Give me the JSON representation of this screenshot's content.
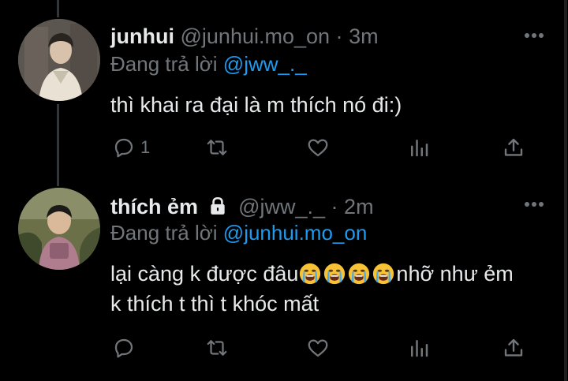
{
  "tweets": [
    {
      "display_name": "junhui",
      "handle": "@junhui.mo_on",
      "separator": "·",
      "time": "3m",
      "reply_prefix": "Đang trả lời",
      "reply_mention": "@jww_._",
      "body_lines": [
        "thì khai ra đại là m thích nó đi:)"
      ],
      "reply_count": "1"
    },
    {
      "display_name": "thích ẻm",
      "handle": "@jww_._",
      "separator": "·",
      "time": "2m",
      "reply_prefix": "Đang trả lời",
      "reply_mention": "@junhui.mo_on",
      "body_line1_before": "lại càng k được đâu",
      "body_line1_after": "nhỡ như ẻm",
      "body_line2": "k thích t thì t khóc mất",
      "emojis": [
        "loudly-crying-face",
        "loudly-crying-face",
        "loudly-crying-face",
        "loudly-crying-face"
      ],
      "reply_count": ""
    }
  ],
  "icons": {
    "more": "more-horizontal-icon",
    "reply": "reply-bubble-icon",
    "retweet": "retweet-icon",
    "like": "heart-icon",
    "views": "analytics-icon",
    "share": "share-icon",
    "lock": "lock-icon"
  },
  "colors": {
    "background": "#000000",
    "text": "#e7e9ea",
    "muted": "#71767b",
    "mention": "#1d9bf0",
    "thread_line": "#333639"
  }
}
